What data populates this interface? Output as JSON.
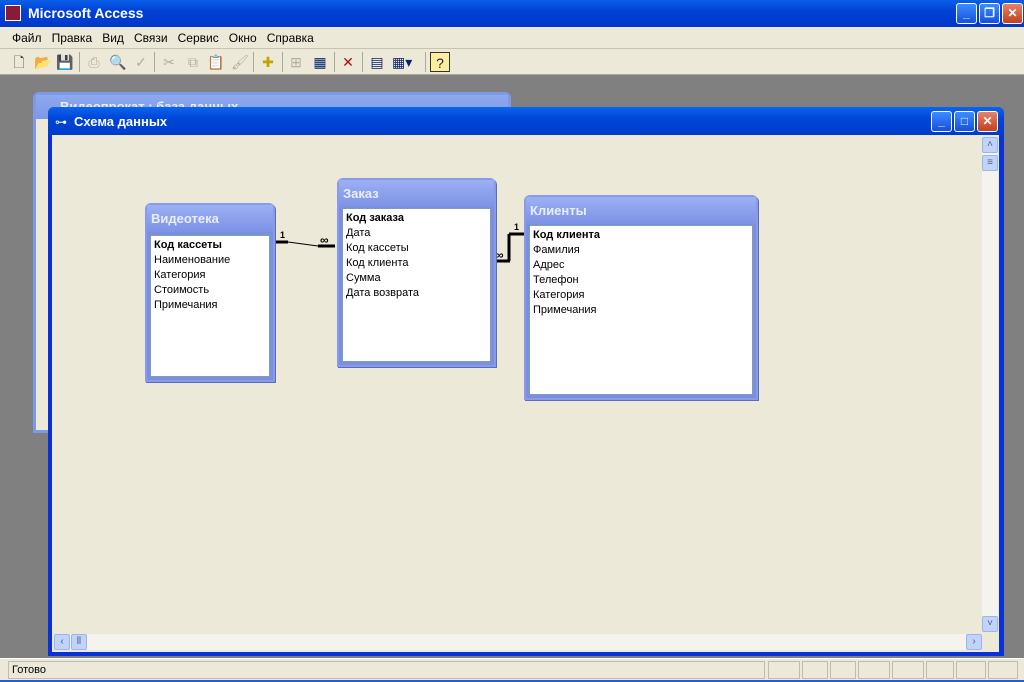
{
  "app": {
    "title": "Microsoft Access"
  },
  "menu": [
    "Файл",
    "Правка",
    "Вид",
    "Связи",
    "Сервис",
    "Окно",
    "Справка"
  ],
  "toolbar": [
    {
      "icon": "new-icon",
      "enabled": true
    },
    {
      "icon": "open-icon",
      "enabled": true
    },
    {
      "icon": "save-icon",
      "enabled": true
    },
    {
      "icon": "print-icon",
      "enabled": false
    },
    {
      "icon": "print-preview-icon",
      "enabled": false
    },
    {
      "icon": "spelling-icon",
      "enabled": false
    },
    {
      "icon": "cut-icon",
      "enabled": false
    },
    {
      "icon": "copy-icon",
      "enabled": false
    },
    {
      "icon": "paste-icon",
      "enabled": false
    },
    {
      "icon": "format-painter-icon",
      "enabled": false
    },
    {
      "icon": "show-table-icon",
      "enabled": true
    },
    {
      "icon": "direct-relationships-icon",
      "enabled": false
    },
    {
      "icon": "all-relationships-icon",
      "enabled": true
    },
    {
      "icon": "delete-icon",
      "enabled": true
    },
    {
      "icon": "database-window-icon",
      "enabled": true
    },
    {
      "icon": "new-object-icon",
      "enabled": true
    },
    {
      "icon": "help-icon",
      "enabled": true
    }
  ],
  "background_window": {
    "title": "Видеопрокат : база данных"
  },
  "schema_window": {
    "title": "Схема данных",
    "tables": [
      {
        "name": "Видеотека",
        "fields": [
          "Код кассеты",
          "Наименование",
          "Категория",
          "Стоимость",
          "Примечания"
        ],
        "key": "Код кассеты"
      },
      {
        "name": "Заказ",
        "fields": [
          "Код заказа",
          "Дата",
          "Код кассеты",
          "Код клиента",
          "Сумма",
          "Дата возврата"
        ],
        "key": "Код заказа"
      },
      {
        "name": "Клиенты",
        "fields": [
          "Код клиента",
          "Фамилия",
          "Адрес",
          "Телефон",
          "Категория",
          "Примечания"
        ],
        "key": "Код клиента"
      }
    ],
    "relationships": [
      {
        "from": "Видеотека.Код кассеты",
        "to": "Заказ.Код кассеты",
        "one": "1",
        "many": "∞"
      },
      {
        "from": "Клиенты.Код клиента",
        "to": "Заказ.Код клиента",
        "one": "1",
        "many": "∞"
      }
    ]
  },
  "status": {
    "text": "Готово"
  }
}
